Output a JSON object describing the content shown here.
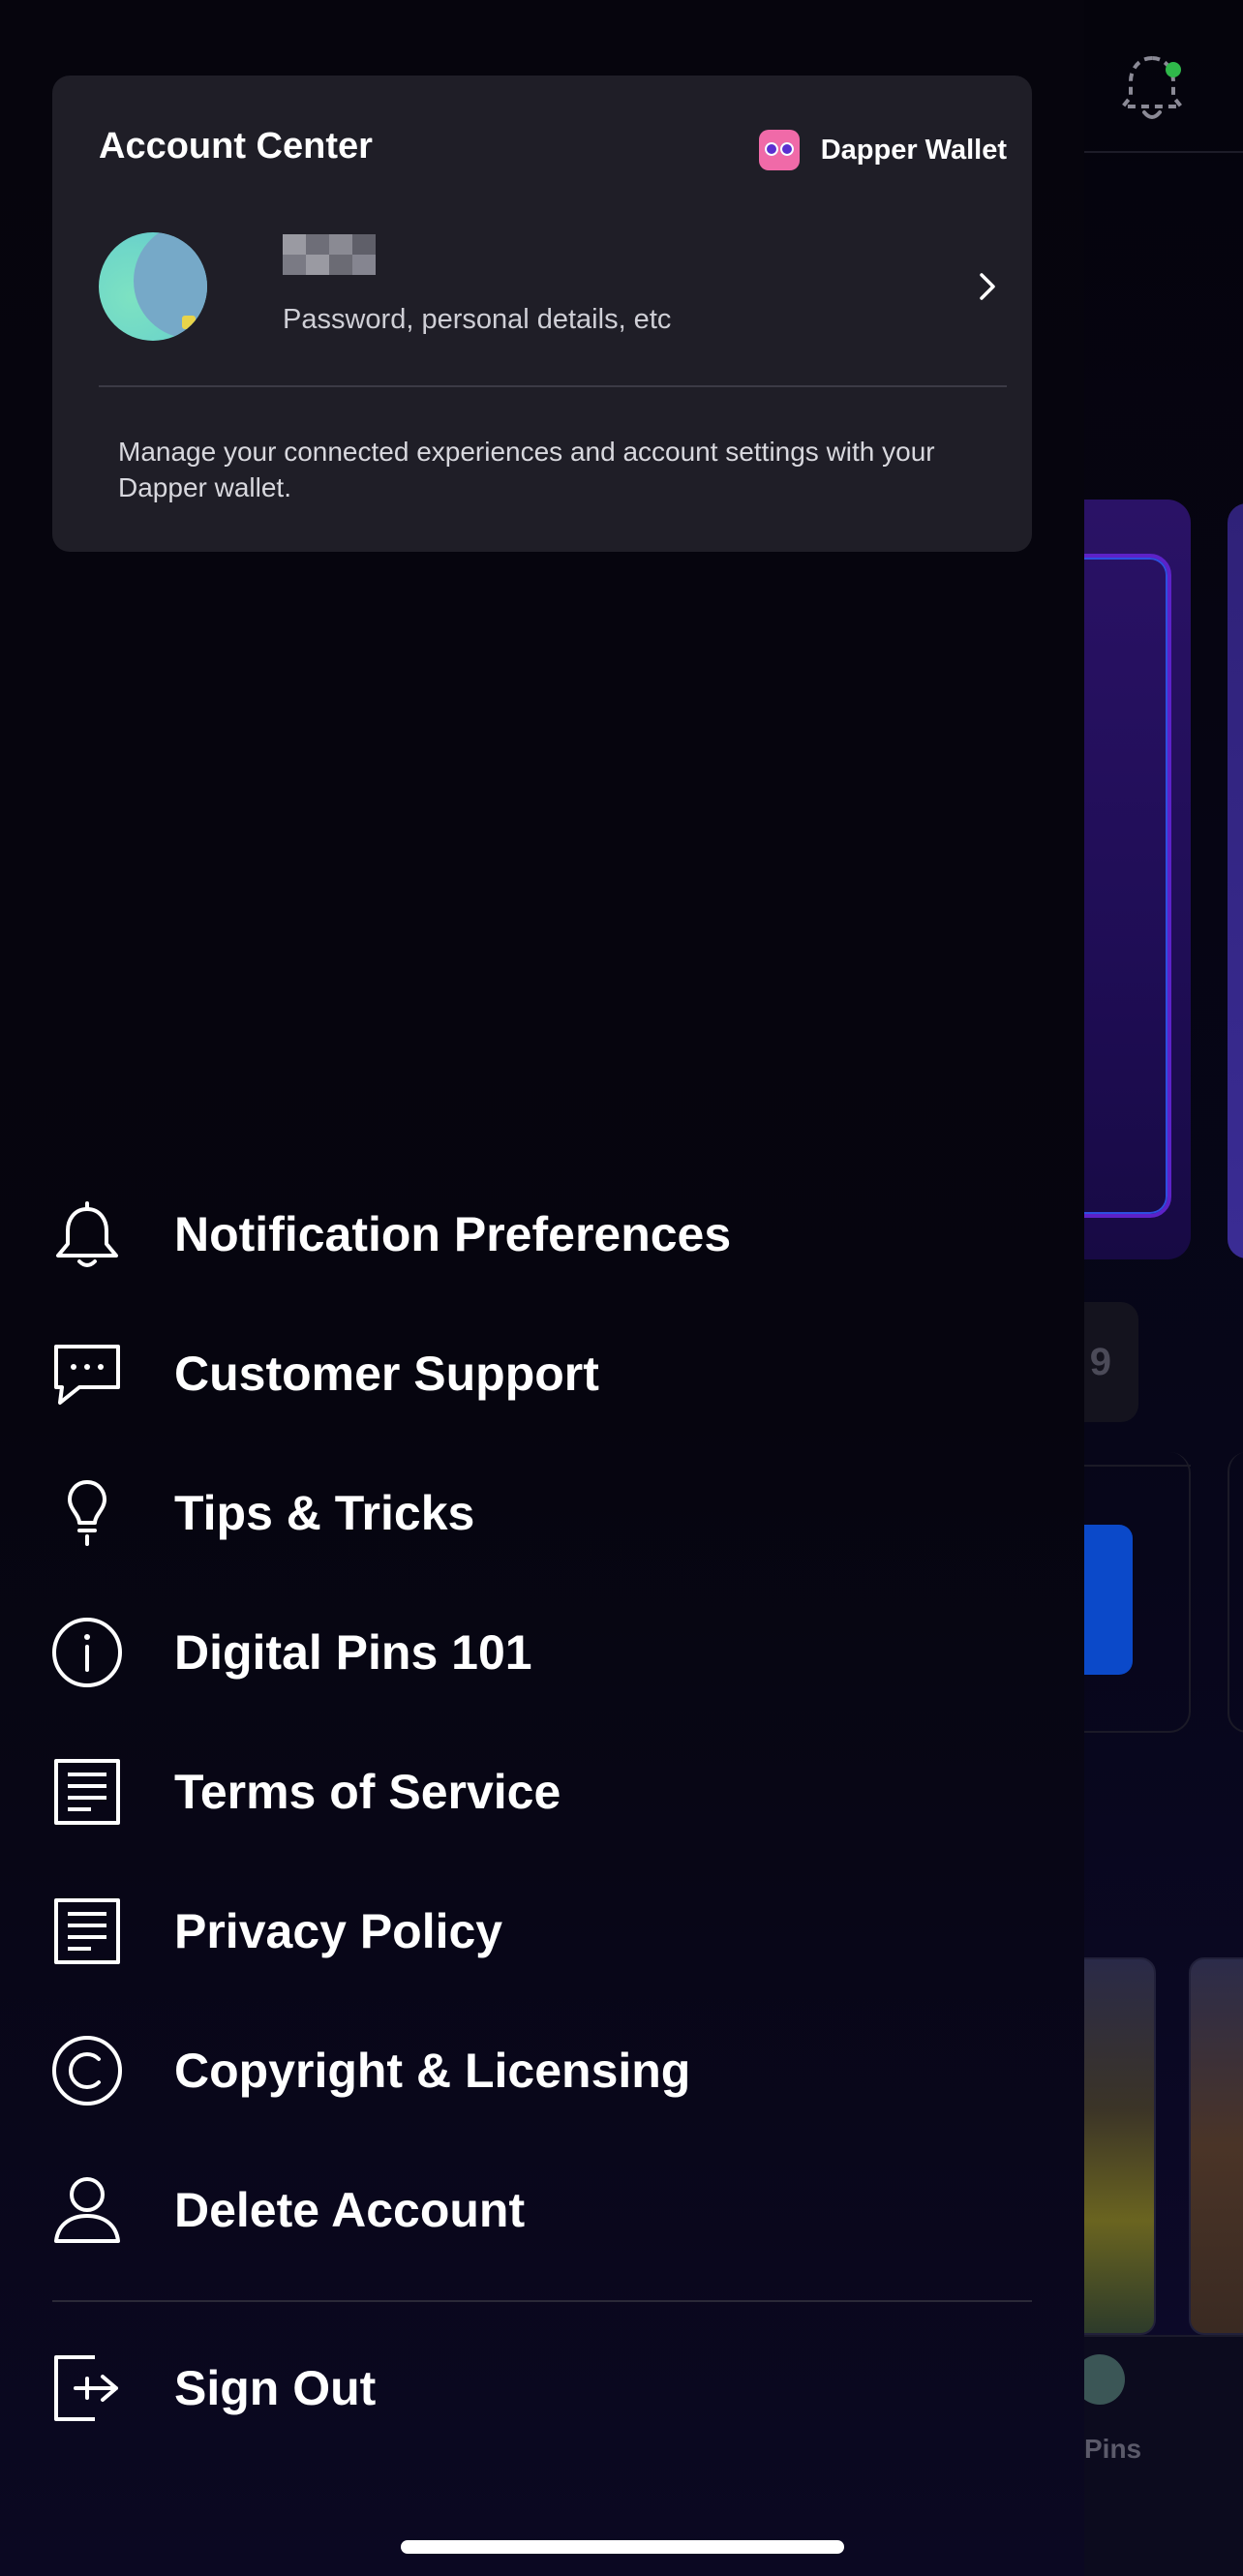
{
  "account_center": {
    "title": "Account Center",
    "wallet_label": "Dapper Wallet",
    "wallet_icon": "dapper-wallet-logo",
    "profile_subtitle": "Password, personal details, etc",
    "description": "Manage your connected experiences and account settings with your Dapper wallet."
  },
  "menu": {
    "items": [
      {
        "label": "Notification Preferences",
        "icon": "bell-icon"
      },
      {
        "label": "Customer Support",
        "icon": "chat-bubble-icon"
      },
      {
        "label": "Tips & Tricks",
        "icon": "lightbulb-icon"
      },
      {
        "label": "Digital Pins 101",
        "icon": "info-icon"
      },
      {
        "label": "Terms of Service",
        "icon": "document-icon"
      },
      {
        "label": "Privacy Policy",
        "icon": "document-icon"
      },
      {
        "label": "Copyright & Licensing",
        "icon": "copyright-icon"
      },
      {
        "label": "Delete Account",
        "icon": "user-icon"
      }
    ],
    "sign_out_label": "Sign Out",
    "sign_out_icon": "sign-out-icon"
  },
  "background": {
    "chip_text": "9",
    "tab_label": "Pins"
  },
  "colors": {
    "drawer_bg": "#06050d",
    "card_bg": "#1f1e27",
    "notification_dot": "#2fb84a",
    "wallet_brand": "#f06aa8"
  }
}
